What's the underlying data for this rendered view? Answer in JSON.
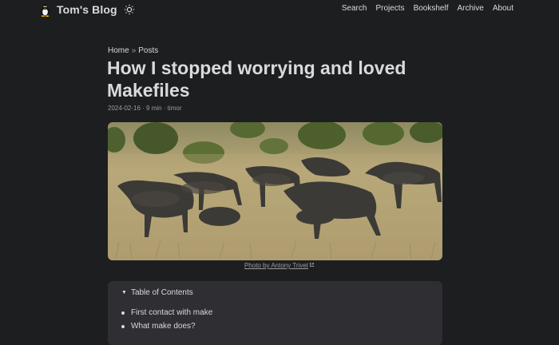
{
  "site": {
    "title": "Tom's Blog",
    "logo_icon": "penguin-icon",
    "theme_icon": "sun-icon"
  },
  "nav": {
    "items": [
      {
        "label": "Search"
      },
      {
        "label": "Projects"
      },
      {
        "label": "Bookshelf"
      },
      {
        "label": "Archive"
      },
      {
        "label": "About"
      }
    ]
  },
  "breadcrumbs": {
    "home": "Home",
    "separator": "»",
    "posts": "Posts"
  },
  "post": {
    "title": "How I stopped worrying and loved Makefiles",
    "meta": "2024-02-16 · 9 min · timor"
  },
  "cover": {
    "caption": "Photo by Antony Trivet",
    "caption_icon": "external-link-icon"
  },
  "toc": {
    "summary": "Table of Contents",
    "items": [
      {
        "label": "First contact with make"
      },
      {
        "label": "What make does?"
      }
    ]
  },
  "colors": {
    "background": "#1d1e20",
    "text": "#dadadb",
    "secondary": "#9b9c9d",
    "toc_background": "#2e2e33"
  }
}
